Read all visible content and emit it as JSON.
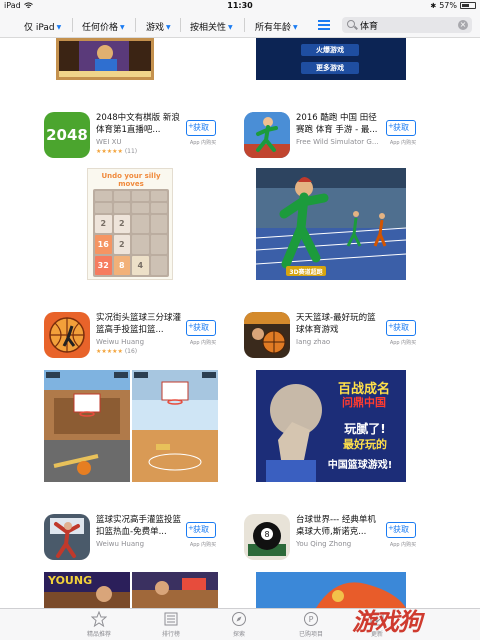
{
  "status_bar": {
    "device": "iPad",
    "time": "11:30",
    "battery": "57%"
  },
  "filters": {
    "device": "仅 iPad",
    "price": "任何价格",
    "category": "游戏",
    "sort": "按相关性",
    "age": "所有年龄"
  },
  "search": {
    "query": "体育"
  },
  "top_banner_right": {
    "line1": "火爆游戏",
    "line2": "更多游戏"
  },
  "apps": [
    {
      "title": "2048中文有棋版 新浪体育第1直播吧...",
      "developer": "WEI XU",
      "rating_count": "(11)",
      "get_label": "获取",
      "iap_label": "App 内购买",
      "icon_text": "2048"
    },
    {
      "title": "2016 酷跑 中国 田径赛跑 体育 手游 - 最...",
      "developer": "Free Wild Simulator G...",
      "get_label": "获取",
      "iap_label": "App 内购买"
    },
    {
      "title": "实况街头篮球三分球灌篮高手投篮扣篮...",
      "developer": "Weiwu Huang",
      "rating_count": "(16)",
      "get_label": "获取",
      "iap_label": "App 内购买"
    },
    {
      "title": "天天篮球-最好玩的篮球体育游戏",
      "developer": "Iang zhao",
      "get_label": "获取",
      "iap_label": "App 内购买"
    },
    {
      "title": "篮球实况高手灌篮投篮扣篮热血-免费单...",
      "developer": "Weiwu Huang",
      "get_label": "获取",
      "iap_label": "App 内购买"
    },
    {
      "title": "台球世界--- 经典单机桌球大师,斯诺克...",
      "developer": "You Qing Zhong",
      "get_label": "获取",
      "iap_label": "App 内购买"
    }
  ],
  "game2048_screenshot": {
    "heading": "Undo your silly moves",
    "tiles": [
      "",
      "",
      "",
      "",
      "",
      "",
      "",
      "",
      "2",
      "2",
      "",
      "",
      "16",
      "2",
      "",
      "",
      "32",
      "8",
      "4",
      ""
    ]
  },
  "race_screenshot": {
    "badge": "3D赛道超跑"
  },
  "basketball_banner": {
    "line1": "百战成名",
    "line2": "问鼎中国",
    "line3": "玩腻了!",
    "line4": "最好玩的",
    "line5": "中国篮球游戏!"
  },
  "young_banner": "YOUNG",
  "tabs": [
    {
      "label": "精品推荐",
      "icon": "star-icon"
    },
    {
      "label": "排行榜",
      "icon": "list-icon"
    },
    {
      "label": "探索",
      "icon": "compass-icon"
    },
    {
      "label": "已购项目",
      "icon": "purchased-icon"
    },
    {
      "label": "更新",
      "icon": "updates-icon"
    }
  ],
  "watermark": "游戏狗"
}
